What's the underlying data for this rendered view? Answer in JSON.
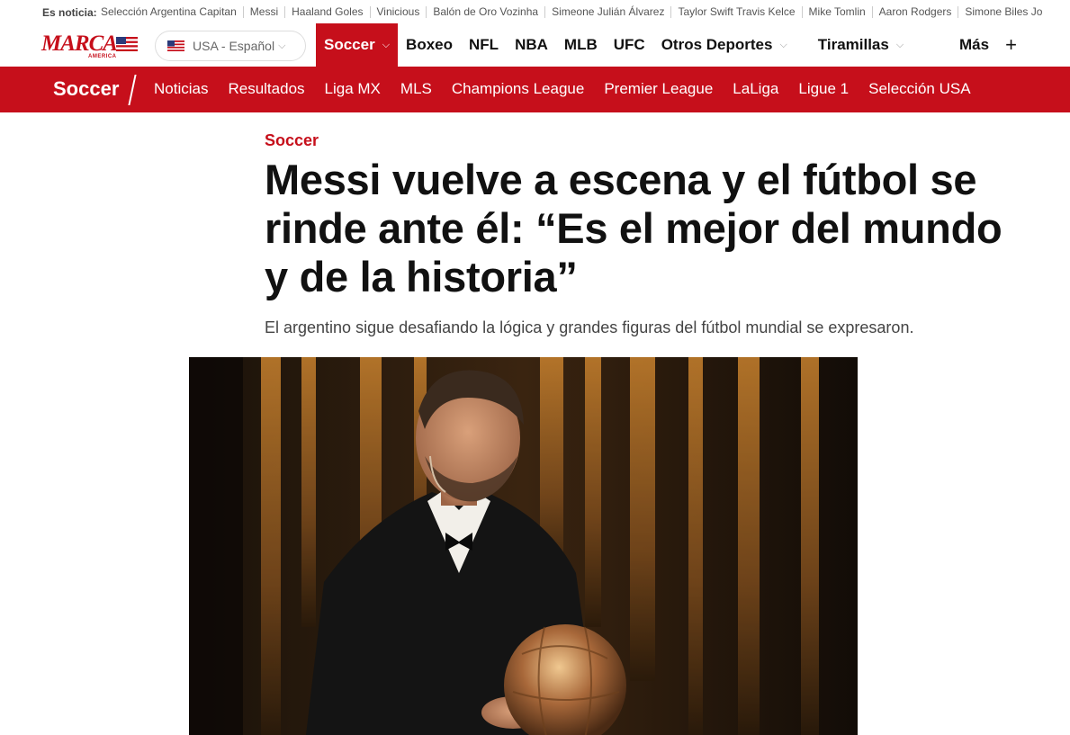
{
  "trending": {
    "label": "Es noticia:",
    "items": [
      "Selección Argentina Capitan",
      "Messi",
      "Haaland Goles",
      "Vinicious",
      "Balón de Oro Vozinha",
      "Simeone Julián Álvarez",
      "Taylor Swift Travis Kelce",
      "Mike Tomlin",
      "Aaron Rodgers",
      "Simone Biles Jo"
    ]
  },
  "logo": {
    "text": "MARCA",
    "sub": "AMERICA"
  },
  "region": {
    "label": "USA - Español"
  },
  "nav": {
    "items": [
      {
        "label": "Soccer",
        "dropdown": true,
        "active": true
      },
      {
        "label": "Boxeo"
      },
      {
        "label": "NFL"
      },
      {
        "label": "NBA"
      },
      {
        "label": "MLB"
      },
      {
        "label": "UFC"
      },
      {
        "label": "Otros Deportes",
        "dropdown": true
      },
      {
        "label": "Tiramillas",
        "dropdown": true
      }
    ],
    "more_label": "Más",
    "plus": "+"
  },
  "section": {
    "title": "Soccer",
    "links": [
      "Noticias",
      "Resultados",
      "Liga MX",
      "MLS",
      "Champions League",
      "Premier League",
      "LaLiga",
      "Ligue 1",
      "Selección USA"
    ]
  },
  "article": {
    "kicker": "Soccer",
    "headline": "Messi vuelve a escena y el fútbol se rinde ante él: “Es el mejor del mundo y de la historia”",
    "standfirst": "El argentino sigue desafiando la lógica y grandes figuras del fútbol mundial se expresaron."
  },
  "colors": {
    "brand_red": "#c60f1b",
    "text": "#111111"
  }
}
